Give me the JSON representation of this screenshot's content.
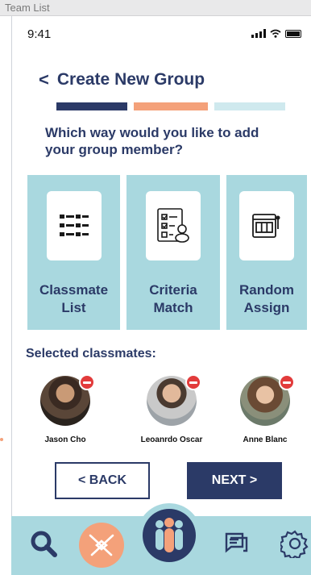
{
  "window": {
    "label": "Team List"
  },
  "status_bar": {
    "time": "9:41"
  },
  "header": {
    "title": "Create New Group"
  },
  "progress": {
    "steps_total": 3,
    "current_step": 2
  },
  "question": "Which way would you like to add your group member?",
  "options": [
    {
      "line1": "Classmate",
      "line2": "List",
      "icon": "list-icon"
    },
    {
      "line1": "Criteria",
      "line2": "Match",
      "icon": "checklist-icon"
    },
    {
      "line1": "Random",
      "line2": "Assign",
      "icon": "slot-machine-icon"
    }
  ],
  "selected": {
    "title": "Selected classmates:",
    "members": [
      {
        "name": "Jason Cho"
      },
      {
        "name": "Leoanrdo Oscar"
      },
      {
        "name": "Anne Blanc"
      }
    ]
  },
  "buttons": {
    "back": "< BACK",
    "next": "NEXT >"
  },
  "tabbar": {
    "items": [
      {
        "icon": "search-icon"
      },
      {
        "icon": "handshake-icon"
      },
      {
        "icon": "group-icon"
      },
      {
        "icon": "chat-icon"
      },
      {
        "icon": "gear-icon"
      }
    ]
  },
  "colors": {
    "primary": "#2b3a67",
    "accent": "#f4a17a",
    "tile": "#a9d8df",
    "remove": "#e23b3b"
  }
}
